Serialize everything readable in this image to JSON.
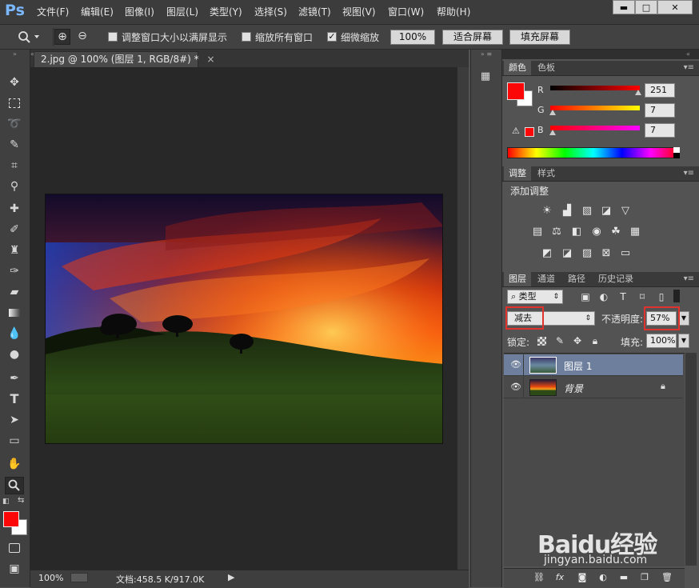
{
  "app": {
    "logo": "Ps"
  },
  "menu": [
    "文件(F)",
    "编辑(E)",
    "图像(I)",
    "图层(L)",
    "类型(Y)",
    "选择(S)",
    "滤镜(T)",
    "视图(V)",
    "窗口(W)",
    "帮助(H)"
  ],
  "window_controls": {
    "minimize": "▬",
    "restore": "□",
    "close": "✕"
  },
  "options": {
    "zoom_in": "⊕",
    "zoom_out": "⊖",
    "resize_windows": "调整窗口大小以满屏显示",
    "zoom_all": "缩放所有窗口",
    "scrubby_zoom": "细微缩放",
    "btn_100": "100%",
    "btn_fit": "适合屏幕",
    "btn_fill": "填充屏幕"
  },
  "document": {
    "tab_title": "2.jpg @ 100% (图层 1, RGB/8#) *",
    "tab_close": "×",
    "zoom": "100%",
    "doc_info": "文档:458.5 K/917.0K"
  },
  "color_panel": {
    "tabs": [
      "颜色",
      "色板"
    ],
    "r_label": "R",
    "g_label": "G",
    "b_label": "B",
    "r": "251",
    "g": "7",
    "b": "7",
    "r_fraction": 0.98,
    "g_fraction": 0.03,
    "b_fraction": 0.03,
    "foreground": "#fb0707",
    "background": "#ffffff"
  },
  "adjust_panel": {
    "tabs": [
      "调整",
      "样式"
    ],
    "title": "添加调整"
  },
  "layers_panel": {
    "tabs": [
      "图层",
      "通道",
      "路径",
      "历史记录"
    ],
    "filter": "类型",
    "blend_mode": "减去",
    "opacity_label": "不透明度:",
    "opacity": "57%",
    "lock_label": "锁定:",
    "fill_label": "填充:",
    "fill": "100%",
    "layers": [
      {
        "name": "图层 1",
        "selected": true
      },
      {
        "name": "背景",
        "selected": false,
        "locked": true
      }
    ]
  },
  "watermark": {
    "brand": "Baidu经验",
    "url": "jingyan.baidu.com"
  },
  "colors": {
    "selection_red": "#e0332e",
    "selected_layer": "#6d7f9c"
  }
}
